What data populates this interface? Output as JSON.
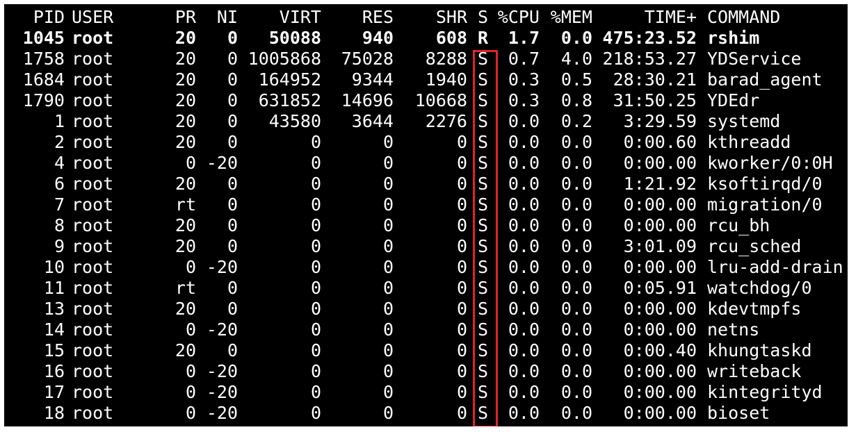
{
  "header": {
    "pid": "PID",
    "user": "USER",
    "pr": "PR",
    "ni": "NI",
    "virt": "VIRT",
    "res": "RES",
    "shr": "SHR",
    "s": "S",
    "cpu": "%CPU",
    "mem": "%MEM",
    "time": "TIME+",
    "command": "COMMAND"
  },
  "processes": [
    {
      "pid": "1045",
      "user": "root",
      "pr": "20",
      "ni": "0",
      "virt": "50088",
      "res": "940",
      "shr": "608",
      "s": "R",
      "cpu": "1.7",
      "mem": "0.0",
      "time": "475:23.52",
      "command": "rshim",
      "bold": true
    },
    {
      "pid": "1758",
      "user": "root",
      "pr": "20",
      "ni": "0",
      "virt": "1005868",
      "res": "75028",
      "shr": "8288",
      "s": "S",
      "cpu": "0.7",
      "mem": "4.0",
      "time": "218:53.27",
      "command": "YDService"
    },
    {
      "pid": "1684",
      "user": "root",
      "pr": "20",
      "ni": "0",
      "virt": "164952",
      "res": "9344",
      "shr": "1940",
      "s": "S",
      "cpu": "0.3",
      "mem": "0.5",
      "time": "28:30.21",
      "command": "barad_agent"
    },
    {
      "pid": "1790",
      "user": "root",
      "pr": "20",
      "ni": "0",
      "virt": "631852",
      "res": "14696",
      "shr": "10668",
      "s": "S",
      "cpu": "0.3",
      "mem": "0.8",
      "time": "31:50.25",
      "command": "YDEdr"
    },
    {
      "pid": "1",
      "user": "root",
      "pr": "20",
      "ni": "0",
      "virt": "43580",
      "res": "3644",
      "shr": "2276",
      "s": "S",
      "cpu": "0.0",
      "mem": "0.2",
      "time": "3:29.59",
      "command": "systemd"
    },
    {
      "pid": "2",
      "user": "root",
      "pr": "20",
      "ni": "0",
      "virt": "0",
      "res": "0",
      "shr": "0",
      "s": "S",
      "cpu": "0.0",
      "mem": "0.0",
      "time": "0:00.60",
      "command": "kthreadd"
    },
    {
      "pid": "4",
      "user": "root",
      "pr": "0",
      "ni": "-20",
      "virt": "0",
      "res": "0",
      "shr": "0",
      "s": "S",
      "cpu": "0.0",
      "mem": "0.0",
      "time": "0:00.00",
      "command": "kworker/0:0H"
    },
    {
      "pid": "6",
      "user": "root",
      "pr": "20",
      "ni": "0",
      "virt": "0",
      "res": "0",
      "shr": "0",
      "s": "S",
      "cpu": "0.0",
      "mem": "0.0",
      "time": "1:21.92",
      "command": "ksoftirqd/0"
    },
    {
      "pid": "7",
      "user": "root",
      "pr": "rt",
      "ni": "0",
      "virt": "0",
      "res": "0",
      "shr": "0",
      "s": "S",
      "cpu": "0.0",
      "mem": "0.0",
      "time": "0:00.00",
      "command": "migration/0"
    },
    {
      "pid": "8",
      "user": "root",
      "pr": "20",
      "ni": "0",
      "virt": "0",
      "res": "0",
      "shr": "0",
      "s": "S",
      "cpu": "0.0",
      "mem": "0.0",
      "time": "0:00.00",
      "command": "rcu_bh"
    },
    {
      "pid": "9",
      "user": "root",
      "pr": "20",
      "ni": "0",
      "virt": "0",
      "res": "0",
      "shr": "0",
      "s": "S",
      "cpu": "0.0",
      "mem": "0.0",
      "time": "3:01.09",
      "command": "rcu_sched"
    },
    {
      "pid": "10",
      "user": "root",
      "pr": "0",
      "ni": "-20",
      "virt": "0",
      "res": "0",
      "shr": "0",
      "s": "S",
      "cpu": "0.0",
      "mem": "0.0",
      "time": "0:00.00",
      "command": "lru-add-drain"
    },
    {
      "pid": "11",
      "user": "root",
      "pr": "rt",
      "ni": "0",
      "virt": "0",
      "res": "0",
      "shr": "0",
      "s": "S",
      "cpu": "0.0",
      "mem": "0.0",
      "time": "0:05.91",
      "command": "watchdog/0"
    },
    {
      "pid": "13",
      "user": "root",
      "pr": "20",
      "ni": "0",
      "virt": "0",
      "res": "0",
      "shr": "0",
      "s": "S",
      "cpu": "0.0",
      "mem": "0.0",
      "time": "0:00.00",
      "command": "kdevtmpfs"
    },
    {
      "pid": "14",
      "user": "root",
      "pr": "0",
      "ni": "-20",
      "virt": "0",
      "res": "0",
      "shr": "0",
      "s": "S",
      "cpu": "0.0",
      "mem": "0.0",
      "time": "0:00.00",
      "command": "netns"
    },
    {
      "pid": "15",
      "user": "root",
      "pr": "20",
      "ni": "0",
      "virt": "0",
      "res": "0",
      "shr": "0",
      "s": "S",
      "cpu": "0.0",
      "mem": "0.0",
      "time": "0:00.40",
      "command": "khungtaskd"
    },
    {
      "pid": "16",
      "user": "root",
      "pr": "0",
      "ni": "-20",
      "virt": "0",
      "res": "0",
      "shr": "0",
      "s": "S",
      "cpu": "0.0",
      "mem": "0.0",
      "time": "0:00.00",
      "command": "writeback"
    },
    {
      "pid": "17",
      "user": "root",
      "pr": "0",
      "ni": "-20",
      "virt": "0",
      "res": "0",
      "shr": "0",
      "s": "S",
      "cpu": "0.0",
      "mem": "0.0",
      "time": "0:00.00",
      "command": "kintegrityd"
    },
    {
      "pid": "18",
      "user": "root",
      "pr": "0",
      "ni": "-20",
      "virt": "0",
      "res": "0",
      "shr": "0",
      "s": "S",
      "cpu": "0.0",
      "mem": "0.0",
      "time": "0:00.00",
      "command": "bioset"
    }
  ],
  "colors": {
    "terminal_background": "#000000",
    "terminal_text": "#ffffff",
    "highlight_border": "#e0242b"
  }
}
